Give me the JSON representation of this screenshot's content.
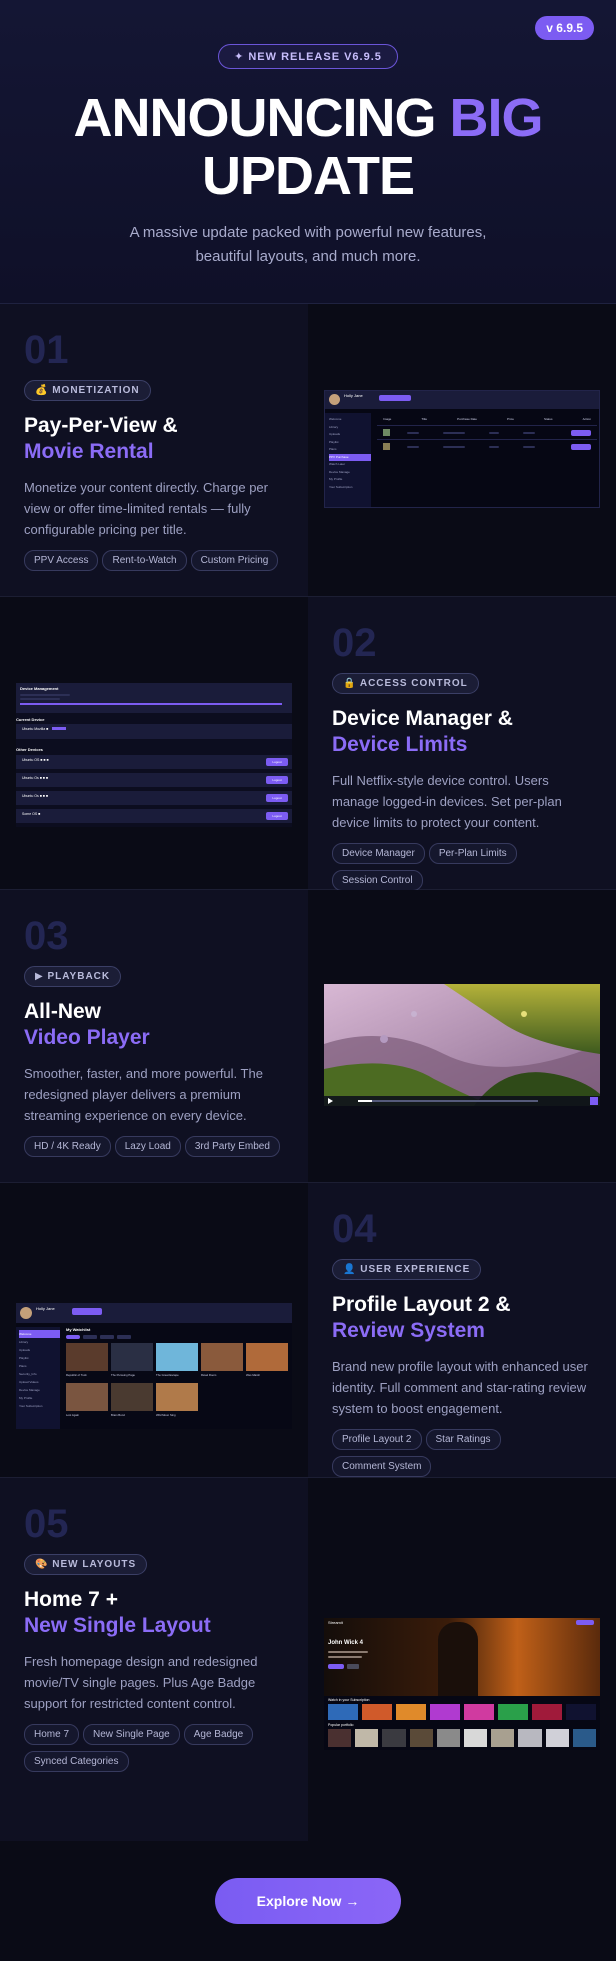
{
  "hero": {
    "version": "v 6.9.5",
    "release_badge": "✦ NEW RELEASE V6.9.5",
    "title_part1": "ANNOUNCING",
    "title_accent": "BIG",
    "title_part2": "UPDATE",
    "subtitle_line1": "A massive update packed with powerful new features,",
    "subtitle_line2": "beautiful layouts, and much more."
  },
  "features": [
    {
      "num": "01",
      "badge": "💰 MONETIZATION",
      "title1": "Pay-Per-View &",
      "title2": "Movie Rental",
      "desc_lines": [
        "Monetize your content directly. Charge per",
        "view or offer time-limited rentals — fully",
        "configurable pricing per title."
      ],
      "tags": [
        "PPV Access",
        "Rent-to-Watch",
        "Custom Pricing"
      ]
    },
    {
      "num": "02",
      "badge": "🔒 ACCESS CONTROL",
      "title1": "Device Manager &",
      "title2": "Device Limits",
      "desc_lines": [
        "Full Netflix-style device control. Users",
        "manage logged-in devices. Set per-plan",
        "device limits to protect your content."
      ],
      "tags": [
        "Device Manager",
        "Per-Plan Limits",
        "Session Control"
      ]
    },
    {
      "num": "03",
      "badge": "▶ PLAYBACK",
      "title1": "All-New",
      "title2": "Video Player",
      "desc_lines": [
        "Smoother, faster, and more powerful. The",
        "redesigned player delivers a premium",
        "streaming experience on every device."
      ],
      "tags": [
        "HD / 4K Ready",
        "Lazy Load",
        "3rd Party Embed"
      ]
    },
    {
      "num": "04",
      "badge": "👤 USER EXPERIENCE",
      "title1": "Profile Layout 2 &",
      "title2": "Review System",
      "desc_lines": [
        "Brand new profile layout with enhanced user",
        "identity. Full comment and star-rating review",
        "system to boost engagement."
      ],
      "tags": [
        "Profile Layout 2",
        "Star Ratings",
        "Comment System"
      ]
    },
    {
      "num": "05",
      "badge": "🎨 NEW LAYOUTS",
      "title1": "Home 7 +",
      "title2": "New Single Layout",
      "desc_lines": [
        "Fresh homepage design and redesigned",
        "movie/TV single pages. Plus Age Badge",
        "support for restricted content control."
      ],
      "tags": [
        "Home 7",
        "New Single Page",
        "Age Badge",
        "Synced Categories"
      ]
    }
  ],
  "shots": {
    "ppv": {
      "user_name": "Holly Jane",
      "menu": [
        "Welcome",
        "Library",
        "Uploads",
        "Playlist",
        "Plans",
        "PPV Purchase",
        "Watch Later",
        "Device Manage",
        "My Profile",
        "Your Subscription"
      ],
      "headers": [
        "Image",
        "Title",
        "Purchase Date",
        "Price",
        "Status",
        "Action"
      ]
    },
    "device": {
      "title": "Device Management",
      "current_label": "Current Device",
      "current_device": "Ubuntu Mozilla ■",
      "other_label": "Other Devices",
      "devices": [
        "Ubuntu OS ■ ■ ■",
        "Ubuntu Os ■ ■ ■",
        "Ubuntu Os ■ ■ ■",
        "Some OS ■"
      ],
      "logout": "Logout"
    },
    "profile": {
      "user_name": "Holly Jane",
      "section": "My Watchlist",
      "menu": [
        "Welcome",
        "Library",
        "Uploads",
        "Playlist",
        "Plans",
        "Security_Info",
        "Upload Videos",
        "Device Manage",
        "My Profile",
        "Your Subscription"
      ],
      "movies": [
        "Republic of Tuck",
        "The Pursuing Page",
        "The Great Escape",
        "Ravel Room",
        "Wes Marsh",
        "Lost Again",
        "Brain Bond",
        "Wild Moon Sing"
      ]
    },
    "home": {
      "logo": "Streamit",
      "hero_title": "John Wick 4",
      "row1": "Watch in your Subscription",
      "row2": "Popular portfolio"
    }
  },
  "cta": "Explore Now →",
  "colors": {
    "accent": "#8b6cf6",
    "button": "#7c5cf2",
    "number": "#232653"
  }
}
